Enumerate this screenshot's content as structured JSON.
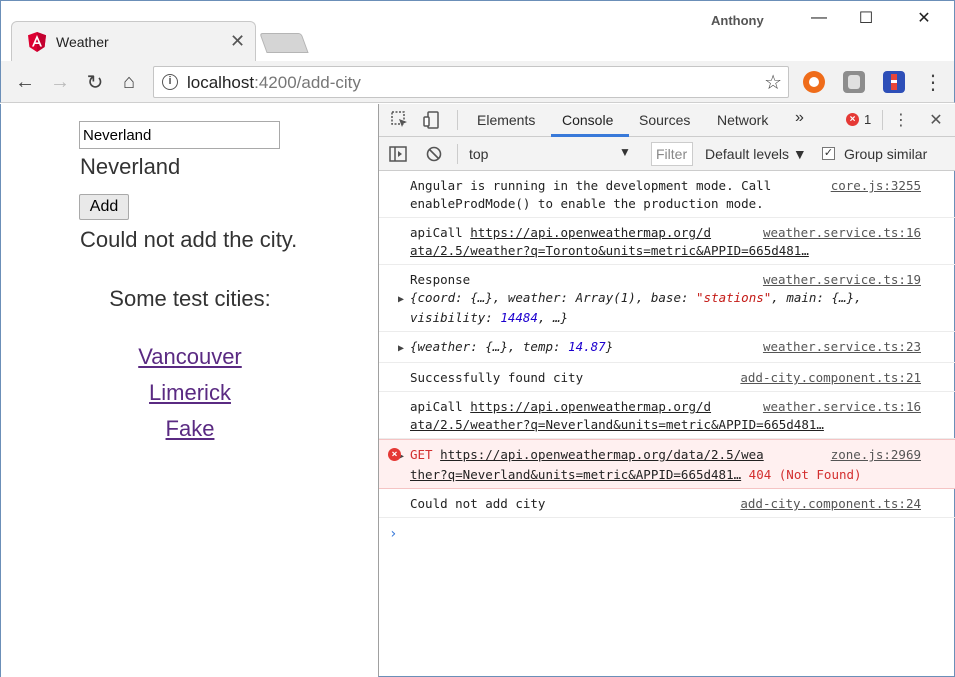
{
  "window": {
    "user": "Anthony",
    "minimize": "—",
    "maximize": "☐",
    "close": "✕"
  },
  "tab": {
    "title": "Weather",
    "close": "✕",
    "icon": "angular-icon"
  },
  "toolbar": {
    "back": "←",
    "forward": "→",
    "reload": "↻",
    "home": "⌂",
    "url_host": "localhost",
    "url_path": ":4200/add-city",
    "star": "☆",
    "menu": "⋮"
  },
  "page": {
    "input_value": "Neverland",
    "echo": "Neverland",
    "add_label": "Add",
    "error": "Could not add the city.",
    "test_title": "Some test cities:",
    "links": [
      "Vancouver",
      "Limerick",
      "Fake"
    ]
  },
  "devtools": {
    "tabs": [
      "Elements",
      "Console",
      "Sources",
      "Network"
    ],
    "more": "»",
    "error_count": "1",
    "context": "top",
    "filter_placeholder": "Filter",
    "levels": "Default levels ▼",
    "group_similar": "Group similar",
    "messages": [
      {
        "text1": "Angular is running in the development mode. Call",
        "text2": "enableProdMode() to enable the production mode.",
        "src": "core.js:3255"
      },
      {
        "prefix": "apiCall ",
        "link1": "https://api.openweathermap.org/d",
        "link2": "ata/2.5/weather?q=Toronto&units=metric&APPID=665d481…",
        "src": "weather.service.ts:16"
      },
      {
        "label": "Response",
        "src": "weather.service.ts:19"
      },
      {
        "text": "Successfully found city",
        "src": "add-city.component.ts:21"
      },
      {
        "prefix": "apiCall ",
        "link1": "https://api.openweathermap.org/d",
        "link2": "ata/2.5/weather?q=Neverland&units=metric&APPID=665d481…",
        "src": "weather.service.ts:16"
      },
      {
        "method": "GET ",
        "link1": "https://api.openweathermap.org/data/2.5/wea",
        "link2": "ther?q=Neverland&units=metric&APPID=665d481…",
        "status": " 404 (Not Found)",
        "src": "zone.js:2969"
      },
      {
        "text": "Could not add city",
        "src": "add-city.component.ts:24"
      }
    ],
    "response_obj": {
      "coord_key": "{coord: ",
      "coord_val": "{…}",
      "weather_key": ", weather: ",
      "weather_val": "Array(1)",
      "base_key": ", base: ",
      "base_val": "\"stations\"",
      "main_key": ", main: ",
      "main_val": "{…},",
      "visibility_key": "visibility: ",
      "visibility_val": "14484",
      "end": ", …}"
    },
    "temp_obj": {
      "weather_key": "{weather: ",
      "weather_val": "{…}",
      "temp_key": ", temp: ",
      "temp_val": "14.87",
      "end": "}",
      "src": "weather.service.ts:23"
    },
    "prompt": "›"
  }
}
